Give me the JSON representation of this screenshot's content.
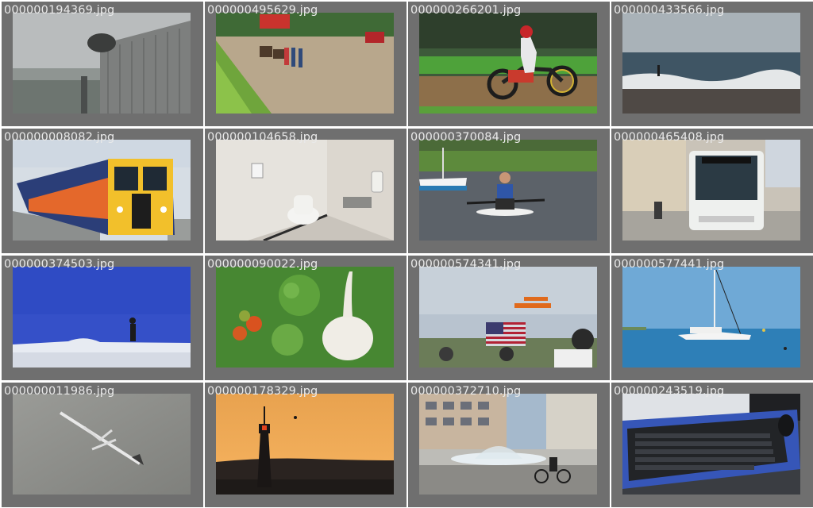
{
  "gallery": {
    "items": [
      {
        "filename": "000000194369.jpg",
        "icon": "building-rooftop-photo"
      },
      {
        "filename": "000000495629.jpg",
        "icon": "horse-field-photo"
      },
      {
        "filename": "000000266201.jpg",
        "icon": "motorcycle-racer-photo"
      },
      {
        "filename": "000000433566.jpg",
        "icon": "beach-surfer-photo"
      },
      {
        "filename": "000000008082.jpg",
        "icon": "train-platform-photo"
      },
      {
        "filename": "000000104658.jpg",
        "icon": "bathroom-toilet-photo"
      },
      {
        "filename": "000000370084.jpg",
        "icon": "paddleboard-lake-photo"
      },
      {
        "filename": "000000465408.jpg",
        "icon": "city-bus-photo"
      },
      {
        "filename": "000000374503.jpg",
        "icon": "snowboarder-photo"
      },
      {
        "filename": "000000090022.jpg",
        "icon": "vegetables-grass-photo"
      },
      {
        "filename": "000000574341.jpg",
        "icon": "biplane-airshow-photo"
      },
      {
        "filename": "000000577441.jpg",
        "icon": "catamaran-sea-photo"
      },
      {
        "filename": "000000011986.jpg",
        "icon": "airplane-sky-photo"
      },
      {
        "filename": "000000178329.jpg",
        "icon": "lighthouse-sunset-photo"
      },
      {
        "filename": "000000372710.jpg",
        "icon": "city-fountain-cyclist-photo"
      },
      {
        "filename": "000000243519.jpg",
        "icon": "keyboard-desk-photo"
      }
    ]
  }
}
